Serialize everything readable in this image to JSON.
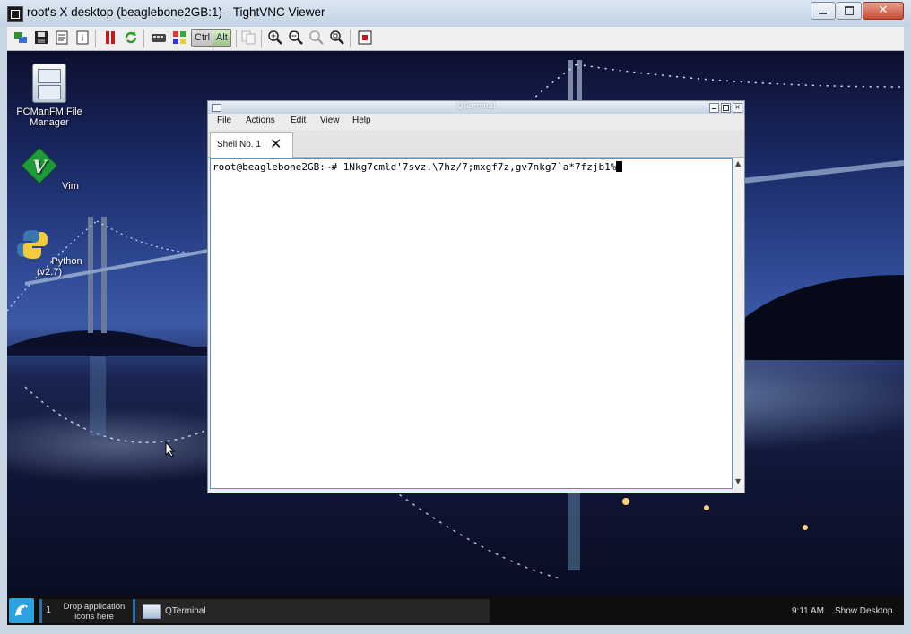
{
  "vnc_window": {
    "title": "root's X desktop (beaglebone2GB:1) - TightVNC Viewer",
    "controls": {
      "minimize": "minimize-icon",
      "maximize": "maximize-icon",
      "close": "close-icon"
    },
    "toolbar": {
      "icons": [
        "new-connection-icon",
        "save-icon",
        "options-icon",
        "info-icon",
        "pause-icon",
        "refresh-icon",
        "ctrl-alt-del-icon",
        "ctrl-esc-icon",
        "zoom-in-icon",
        "zoom-out-icon",
        "zoom-100-icon",
        "zoom-fit-icon",
        "fullscreen-icon"
      ],
      "ctrl_label": "Ctrl",
      "alt_label": "Alt"
    }
  },
  "desktop": {
    "icons": [
      {
        "name": "PCManFM File Manager"
      },
      {
        "name": "Vim"
      },
      {
        "name": "Python (v2.7)"
      }
    ]
  },
  "qterminal": {
    "title": "QTerminal",
    "menu": [
      "File",
      "Actions",
      "Edit",
      "View",
      "Help"
    ],
    "tab_label": "Shell No. 1",
    "prompt": "root@beaglebone2GB:~#",
    "command": " 1Nkg7cmld'7svz.\\7hz/7;mxgf7z,gv7nkg7`a*7fzjb1%"
  },
  "panel": {
    "workspace_number": "1",
    "drop_text_line1": "Drop application",
    "drop_text_line2": "icons here",
    "task_label": "QTerminal",
    "clock": "9:11 AM",
    "show_desktop": "Show Desktop"
  },
  "colors": {
    "terminal_border": "#4a97c8",
    "panel_bg": "#0e0e0e",
    "start_button": "#2aa2e0"
  }
}
